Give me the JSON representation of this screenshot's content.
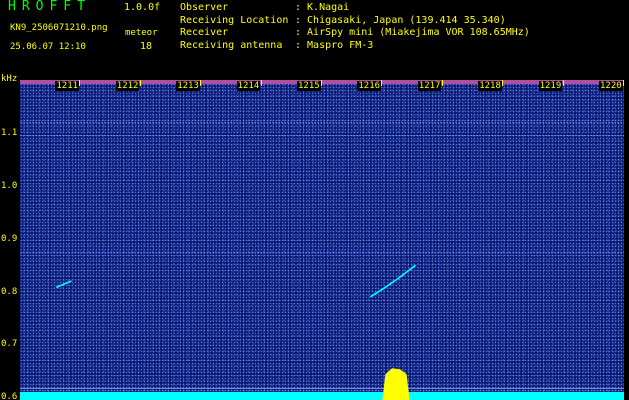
{
  "app": {
    "title": "HROFFT",
    "version": "1.0.0f",
    "filename": "KN9_2506071210.png",
    "datetime": "25.06.07 12:10",
    "meteor_label": "meteor",
    "meteor_count": "18"
  },
  "info": [
    {
      "label": "Observer",
      "value": ": K.Nagai"
    },
    {
      "label": "Receiving Location",
      "value": ": Chigasaki, Japan (139.414 35.340)"
    },
    {
      "label": "Receiver",
      "value": ": AirSpy mini (Miakejima VOR 108.65MHz)"
    },
    {
      "label": "Receiving antenna",
      "value": ": Maspro FM-3"
    }
  ],
  "colors": {
    "label_yellow": "#ffff00",
    "title_green": "#00ff00",
    "background": "#051770",
    "signal_cyan": "#00ffff",
    "overload_yellow": "#ffff00"
  },
  "chart_data": {
    "type": "heatmap",
    "y_unit": "kHz",
    "ylim": [
      0.595,
      1.2
    ],
    "y_ticks": [
      {
        "label": "1.1",
        "value": 1.1
      },
      {
        "label": "1.0",
        "value": 1.0
      },
      {
        "label": "0.9",
        "value": 0.9
      },
      {
        "label": "0.8",
        "value": 0.8
      },
      {
        "label": "0.7",
        "value": 0.7
      },
      {
        "label": "0.6",
        "value": 0.6
      }
    ],
    "xlim": [
      1210,
      1220
    ],
    "x_ticks": [
      {
        "label": "1211",
        "value": 1211
      },
      {
        "label": "1212",
        "value": 1212
      },
      {
        "label": "1213",
        "value": 1213
      },
      {
        "label": "1214",
        "value": 1214
      },
      {
        "label": "1215",
        "value": 1215
      },
      {
        "label": "1216",
        "value": 1216
      },
      {
        "label": "1217",
        "value": 1217
      },
      {
        "label": "1218",
        "value": 1218
      },
      {
        "label": "1219",
        "value": 1219
      },
      {
        "label": "1220",
        "value": 1220
      }
    ],
    "constant_lines_khz": [
      1.12,
      1.095,
      0.873,
      0.617,
      0.603
    ],
    "meteor_echoes": [
      {
        "points": [
          [
            1215.8,
            0.79
          ],
          [
            1216.05,
            0.808
          ],
          [
            1216.3,
            0.828
          ],
          [
            1216.55,
            0.85
          ]
        ]
      },
      {
        "points": [
          [
            1210.6,
            0.808
          ],
          [
            1210.85,
            0.82
          ]
        ]
      }
    ],
    "overload_bursts": [
      {
        "start": 1216.0,
        "end": 1216.45,
        "level": 0.06
      }
    ]
  }
}
